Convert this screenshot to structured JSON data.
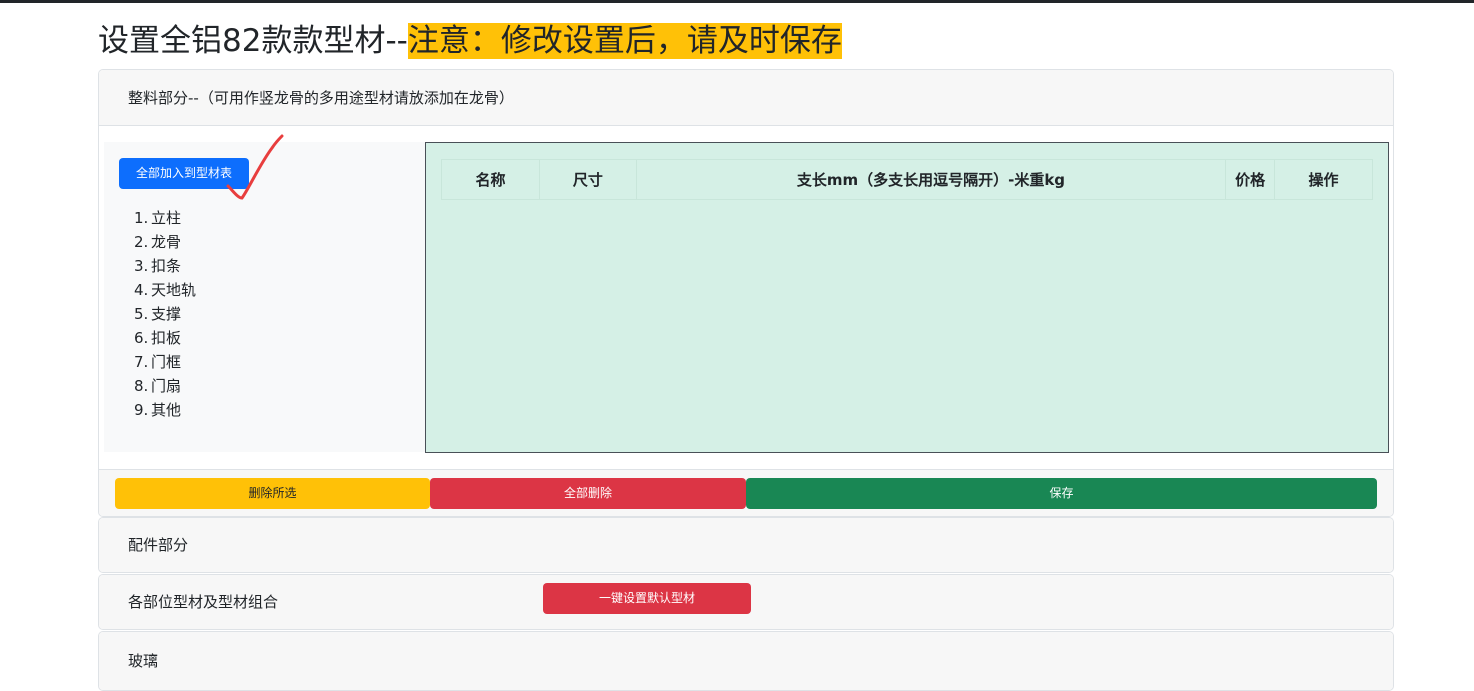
{
  "page": {
    "title_prefix": "设置全铝82款款型材--",
    "title_notice": "注意：修改设置后，请及时保存"
  },
  "main_section": {
    "header": "整料部分--（可用作竖龙骨的多用途型材请放添加在龙骨）",
    "add_all_label": "全部加入到型材表",
    "categories": [
      {
        "num": "1.",
        "name": "立柱"
      },
      {
        "num": "2.",
        "name": "龙骨"
      },
      {
        "num": "3.",
        "name": "扣条"
      },
      {
        "num": "4.",
        "name": "天地轨"
      },
      {
        "num": "5.",
        "name": "支撑"
      },
      {
        "num": "6.",
        "name": "扣板"
      },
      {
        "num": "7.",
        "name": "门框"
      },
      {
        "num": "8.",
        "name": "门扇"
      },
      {
        "num": "9.",
        "name": "其他"
      }
    ],
    "table_headers": {
      "name": "名称",
      "size": "尺寸",
      "length": "支长mm（多支长用逗号隔开）-米重kg",
      "price": "价格",
      "action": "操作"
    },
    "delete_selected_label": "删除所选",
    "delete_all_label": "全部删除",
    "save_label": "保存"
  },
  "parts_section": {
    "header": "配件部分"
  },
  "combo_section": {
    "header": "各部位型材及型材组合",
    "set_default_label": "一键设置默认型材"
  },
  "glass_section": {
    "header": "玻璃"
  },
  "colors": {
    "primary": "#0d6efd",
    "warning": "#ffc107",
    "danger": "#dc3545",
    "success": "#198754",
    "table_bg": "#d5f0e6",
    "checkmark": "#e83e3e"
  },
  "icons": {
    "annotation": "checkmark-icon"
  }
}
